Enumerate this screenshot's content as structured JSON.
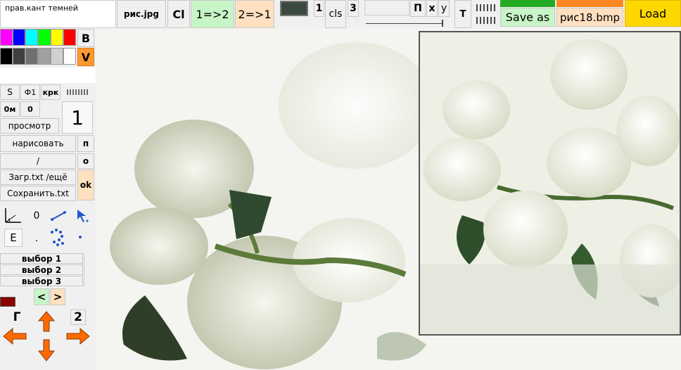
{
  "toolbar": {
    "status_text": "прав.кант темней",
    "file_button": "рис.jpg",
    "clear_button": "Cl",
    "copy_1_to_2": "1=>2",
    "copy_2_to_1": "2=>1",
    "slot_1": "1",
    "cls_button": "cls",
    "slot_3": "3",
    "p_button": "П",
    "x_button": "x",
    "y_button": "y",
    "t_button": "T",
    "save_as_button": "Save as",
    "save_filename": "рис18.bmp",
    "load_button": "Load",
    "current_color_hex": "#3a4a3e",
    "save_as_bar_color": "#22aa22",
    "filename_bar_color": "#ff8822",
    "load_bg_color": "#ffd700"
  },
  "palette": {
    "row1": [
      "#ff00ff",
      "#0000ff",
      "#00ffff",
      "#00ff00",
      "#ffff00",
      "#ff0000"
    ],
    "row2": [
      "#000000",
      "#404040",
      "#707070",
      "#a0a0a0",
      "#d0d0d0",
      "#ffffff"
    ],
    "b_button": "B",
    "v_button": "V"
  },
  "left_panel": {
    "s_button": "S",
    "f1_button": "Ф1",
    "krk_button": "крк",
    "om_button": "0м",
    "zero_button": "0",
    "big_number": "1",
    "preview_button": "просмотр",
    "draw_button": "нарисовать",
    "p_button": "п",
    "slash_button": "/",
    "o_button": "о",
    "load_txt_button": "Загр.txt /ещё",
    "ok_button": "ok",
    "save_txt_button": "Сохранить.txt",
    "zero_label": "0",
    "e_button": "E",
    "dot_label": ".",
    "choice_1": "выбор 1",
    "choice_2": "выбор 2",
    "choice_3": "выбор 3",
    "prev_button": "<",
    "next_button": ">",
    "g_label": "Г",
    "two_label": "2",
    "selected_color_hex": "#8b0000"
  }
}
